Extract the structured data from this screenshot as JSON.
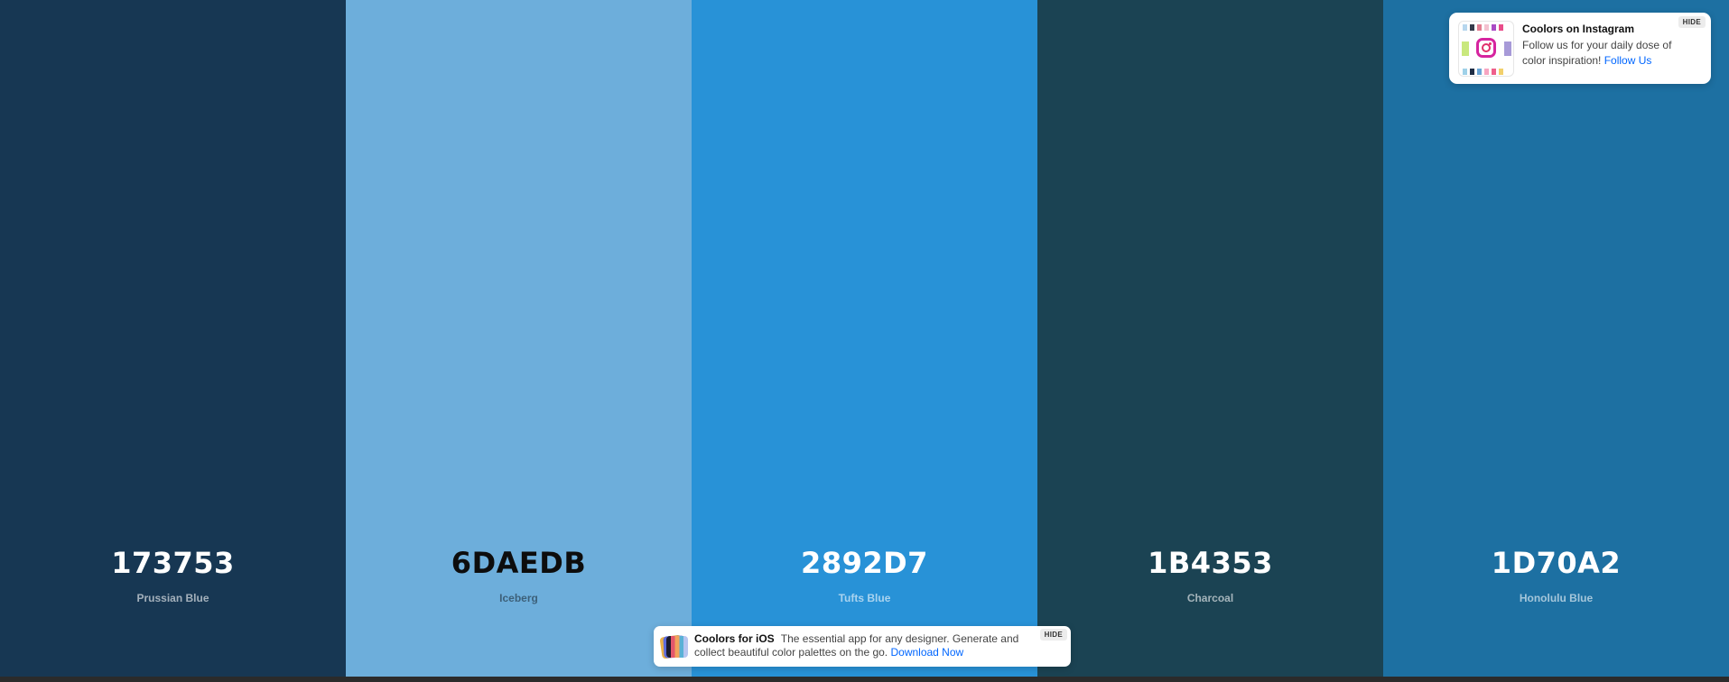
{
  "palette": [
    {
      "hex": "173753",
      "name": "Prussian Blue",
      "bg": "#173753",
      "tone": "light"
    },
    {
      "hex": "6DAEDB",
      "name": "Iceberg",
      "bg": "#6DAEDB",
      "tone": "dark"
    },
    {
      "hex": "2892D7",
      "name": "Tufts Blue",
      "bg": "#2892D7",
      "tone": "light"
    },
    {
      "hex": "1B4353",
      "name": "Charcoal",
      "bg": "#1B4353",
      "tone": "light"
    },
    {
      "hex": "1D70A2",
      "name": "Honolulu Blue",
      "bg": "#1D70A2",
      "tone": "light"
    }
  ],
  "instagram_toast": {
    "title": "Coolors on Instagram",
    "body": "Follow us for your daily dose of color inspiration!",
    "link": "Follow Us",
    "hide": "HIDE",
    "icon": "instagram-icon"
  },
  "ios_toast": {
    "title": "Coolors for iOS",
    "body": "The essential app for any designer. Generate and collect beautiful color palettes on the go.",
    "link": "Download Now",
    "hide": "HIDE",
    "icon": "coolors-app-icon"
  },
  "colors": {
    "link": "#0066ff",
    "bottom_bar": "#2b2b2b"
  }
}
